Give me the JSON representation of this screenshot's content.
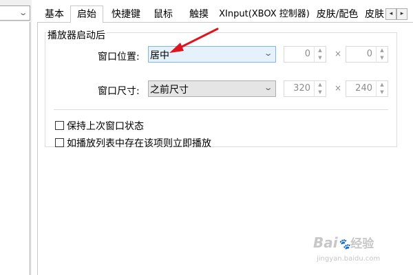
{
  "tabs": {
    "items": [
      "基本",
      "启始",
      "快捷键",
      "鼠标",
      "触摸",
      "XInput(XBOX 控制器)",
      "皮肤/配色",
      "皮肤"
    ],
    "active_index": 1,
    "scroll_left_icon": "chevron-left-icon",
    "scroll_right_icon": "chevron-right-icon"
  },
  "startup": {
    "group_title": "播放器启动后",
    "window_position": {
      "label": "窗口位置:",
      "value": "居中",
      "x": "0",
      "y": "0"
    },
    "window_size": {
      "label": "窗口尺寸:",
      "value": "之前尺寸",
      "width": "320",
      "height": "240"
    },
    "times_symbol": "×",
    "options": [
      {
        "label": "保持上次窗口状态",
        "checked": false
      },
      {
        "label": "如播放列表中存在该项则立即播放",
        "checked": false
      }
    ]
  },
  "annotation": {
    "arrow_color": "#e0141e"
  },
  "watermark": {
    "logo": "Bai",
    "logo_suffix": "经验",
    "url": "jingyan.baidu.com"
  }
}
